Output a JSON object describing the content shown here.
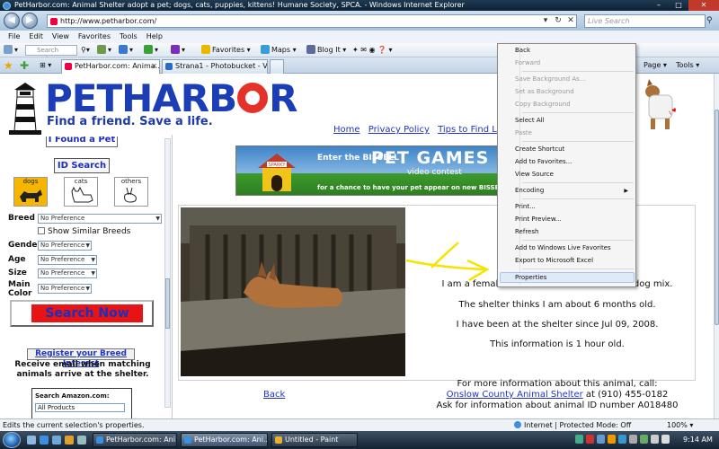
{
  "window": {
    "title": "PetHarbor.com: Animal Shelter adopt a pet; dogs, cats, puppies, kittens! Humane Society, SPCA. - Windows Internet Explorer",
    "minimize": "–",
    "maximize": "□",
    "close": "✕"
  },
  "address": {
    "back": "◀",
    "forward": "▶",
    "url": "http://www.petharbor.com/",
    "dropdown": "▾",
    "refresh": "↻",
    "stop": "✕",
    "search_placeholder": "Live Search",
    "search_go": "⚲"
  },
  "menu": [
    "File",
    "Edit",
    "View",
    "Favorites",
    "Tools",
    "Help"
  ],
  "linkbar": {
    "search_placeholder": "Search web...",
    "favorites": "Favorites",
    "maps": "Maps",
    "blogit": "Blog It"
  },
  "tabs": [
    {
      "label": "PetHarbor.com: Anima...",
      "active": true
    },
    {
      "label": "Strana1 - Photobucket - Vi...",
      "active": false
    }
  ],
  "tabbar_right": {
    "page": "Page ▾",
    "tools": "Tools ▾"
  },
  "site": {
    "logo_brand": "PETHARB",
    "logo_letters_end": "R",
    "tagline": "Find a friend. Save a life.",
    "top_links": [
      "Home",
      "Privacy Policy",
      "Tips to Find Lost P"
    ],
    "found_pet_partial": "I Found a Pet",
    "id_search": "ID Search",
    "pet_types": [
      "dogs",
      "cats",
      "others"
    ],
    "fields": {
      "breed": "Breed",
      "gender": "Gender",
      "age": "Age",
      "size": "Size",
      "main_color": "Main Color"
    },
    "no_pref": "No Preference",
    "show_similar": "Show Similar Breeds",
    "search_now": "Search Now",
    "register": "Register your Breed Interest",
    "register_note": "Receive email when matching animals arrive at the shelter.",
    "amazon_title": "Search Amazon.com:",
    "amazon_select": "All Products"
  },
  "banner": {
    "sign": "SPARKY",
    "line1": "Enter the BISSELL",
    "line2": "PET GAMES",
    "line3": "video contest",
    "line4": "for a chance to have your pet appear on new BISSELL packaging"
  },
  "pet": {
    "line1": "I am a female,",
    "line1_end": "dog mix.",
    "line2": "The shelter thinks I am about 6 months old.",
    "line3": "I have been at the shelter since Jul 09, 2008.",
    "line4": "This information is 1 hour old.",
    "back": "Back",
    "contact1": "For more information about this animal, call:",
    "shelter": "Onslow County Animal Shelter",
    "phone": " at (910) 455-0182",
    "animal_id": "Ask for information about animal ID number A018480"
  },
  "context_menu": {
    "items": [
      {
        "label": "Back",
        "disabled": false
      },
      {
        "label": "Forward",
        "disabled": true
      },
      {
        "label": "Save Background As...",
        "disabled": true
      },
      {
        "label": "Set as Background",
        "disabled": true
      },
      {
        "label": "Copy Background",
        "disabled": true
      },
      {
        "label": "Select All",
        "disabled": false
      },
      {
        "label": "Paste",
        "disabled": true
      },
      {
        "label": "Create Shortcut",
        "disabled": false
      },
      {
        "label": "Add to Favorites...",
        "disabled": false
      },
      {
        "label": "View Source",
        "disabled": false
      },
      {
        "label": "Encoding",
        "disabled": false
      },
      {
        "label": "Print...",
        "disabled": false
      },
      {
        "label": "Print Preview...",
        "disabled": false
      },
      {
        "label": "Refresh",
        "disabled": false
      },
      {
        "label": "Add to Windows Live Favorites",
        "disabled": false
      },
      {
        "label": "Export to Microsoft Excel",
        "disabled": false
      },
      {
        "label": "Properties",
        "disabled": false,
        "highlighted": true
      }
    ],
    "submenu_arrow": "▶"
  },
  "status": {
    "text": "Edits the current selection's properties.",
    "zone": "Internet | Protected Mode: Off",
    "zoom": "100% ▾"
  },
  "taskbar": {
    "buttons": [
      "PetHarbor.com: Ani...",
      "PetHarbor.com: Ani...",
      "Untitled - Paint"
    ],
    "clock": "9:14 AM"
  },
  "colors": {
    "brand_blue": "#1b3db5",
    "brand_red": "#e43228",
    "link": "#1f35c0",
    "search_now_bg": "#e81414"
  }
}
